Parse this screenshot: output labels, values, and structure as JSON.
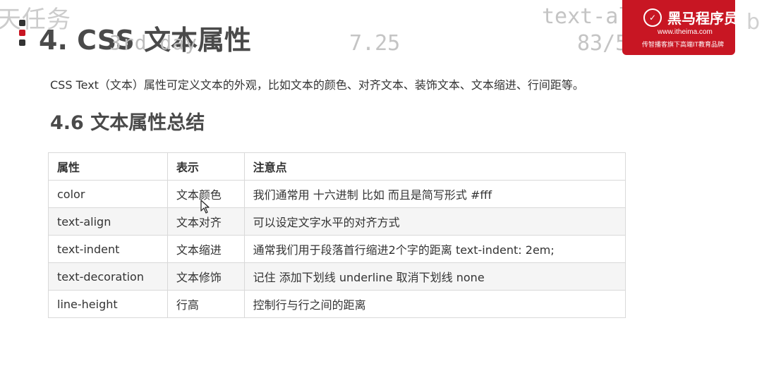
{
  "overlay": {
    "task": "天任务",
    "day": "3rd day",
    "date": "7.25",
    "topic": "text-align",
    "progress": "83/528",
    "edge": "b"
  },
  "brand": {
    "name": "黑马程序员",
    "url": "www.itheima.com",
    "slogan": "传智播客旗下高端IT教育品牌",
    "color": "#c81623"
  },
  "header": {
    "chapter_title": "4. CSS 文本属性"
  },
  "intro": "CSS Text（文本）属性可定义文本的外观，比如文本的颜色、对齐文本、装饰文本、文本缩进、行间距等。",
  "section": {
    "title": "4.6 文本属性总结"
  },
  "table": {
    "headers": [
      "属性",
      "表示",
      "注意点"
    ],
    "rows": [
      [
        "color",
        "文本颜色",
        "我们通常用 十六进制 比如 而且是简写形式 #fff"
      ],
      [
        "text-align",
        "文本对齐",
        "可以设定文字水平的对齐方式"
      ],
      [
        "text-indent",
        "文本缩进",
        "通常我们用于段落首行缩进2个字的距离 text-indent: 2em;"
      ],
      [
        "text-decoration",
        "文本修饰",
        "记住 添加下划线 underline 取消下划线 none"
      ],
      [
        "line-height",
        "行高",
        "控制行与行之间的距离"
      ]
    ]
  }
}
